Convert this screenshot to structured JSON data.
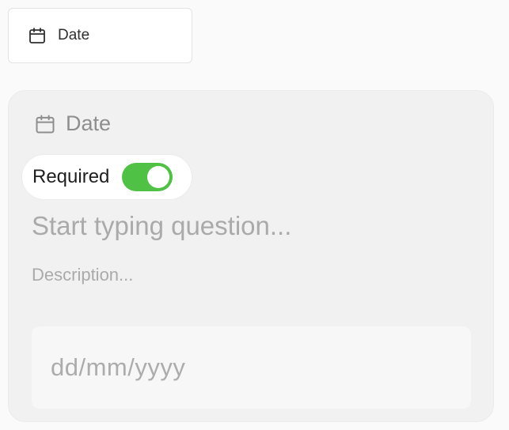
{
  "chip": {
    "icon": "calendar-icon",
    "label": "Date"
  },
  "card": {
    "header": {
      "icon": "calendar-icon",
      "label": "Date"
    },
    "required": {
      "label": "Required",
      "enabled": true
    },
    "question": {
      "placeholder": "Start typing question..."
    },
    "description": {
      "placeholder": "Description..."
    },
    "date_input": {
      "placeholder": "dd/mm/yyyy"
    }
  },
  "colors": {
    "toggle_on": "#4fc145",
    "card_background": "#f1f1f1",
    "placeholder_text": "#aaaaaa"
  }
}
